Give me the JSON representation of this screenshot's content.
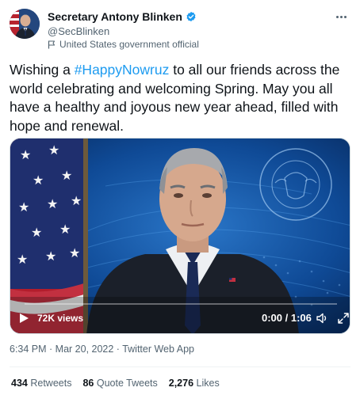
{
  "author": {
    "display_name": "Secretary Antony Blinken",
    "handle": "@SecBlinken",
    "label": "United States government official",
    "verified_icon": "verified-badge-icon",
    "label_icon": "flag-icon"
  },
  "tweet": {
    "text_before": "Wishing a ",
    "hashtag": "#HappyNowruz",
    "text_after": " to all our friends across the world celebrating and welcoming Spring. May you all have a healthy and joyous new year ahead, filled with hope and renewal."
  },
  "video": {
    "views": "72K views",
    "time": "0:00 / 1:06",
    "seal_text_top": "DEPARTMENT OF STATE",
    "seal_text_bottom": "UNITED STATES OF AMERICA"
  },
  "meta": {
    "timestamp": "6:34 PM · Mar 20, 2022 · Twitter Web App"
  },
  "stats": {
    "retweets_count": "434",
    "retweets_label": "Retweets",
    "quotes_count": "86",
    "quotes_label": "Quote Tweets",
    "likes_count": "2,276",
    "likes_label": "Likes"
  },
  "colors": {
    "accent": "#1d9bf0",
    "text": "#0f1419",
    "muted": "#536471"
  }
}
